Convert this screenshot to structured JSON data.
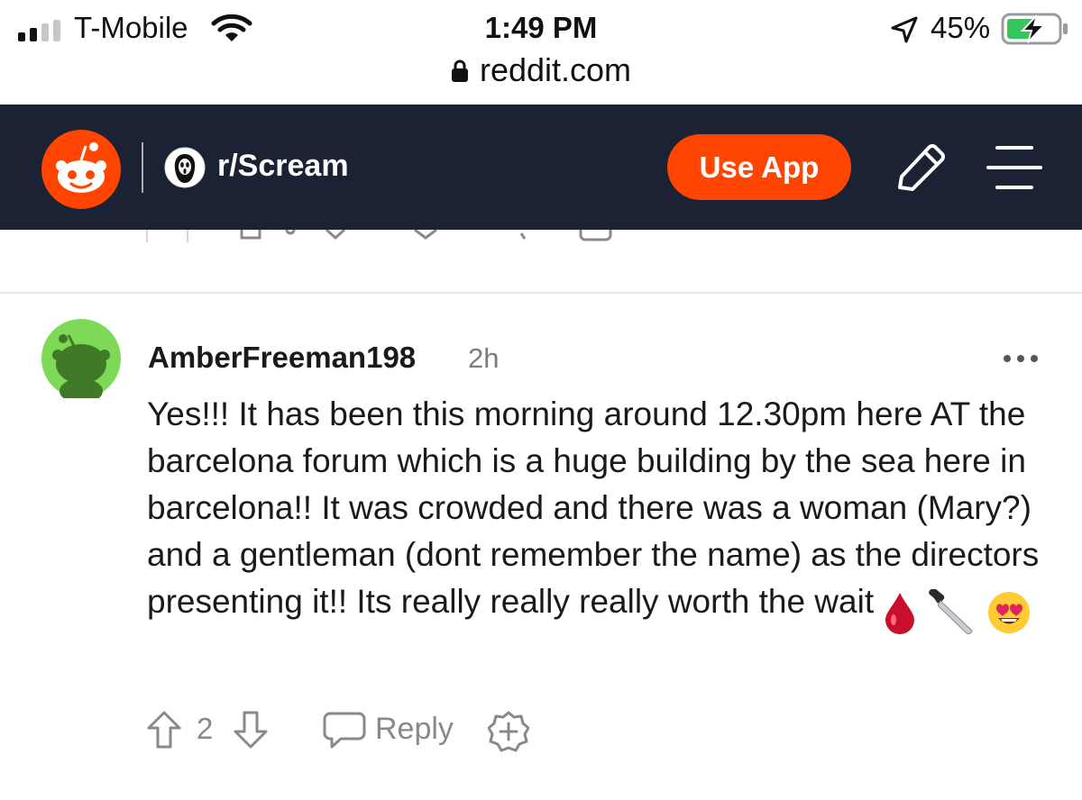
{
  "status_bar": {
    "carrier": "T-Mobile",
    "time": "1:49 PM",
    "url": "reddit.com",
    "battery_percent": "45%",
    "icons": [
      "signal-icon",
      "wifi-icon",
      "lock-icon",
      "location-arrow-icon",
      "battery-charging-icon"
    ]
  },
  "header": {
    "logo_icon": "reddit-snoo-logo",
    "subreddit_icon": "ghostface-icon",
    "subreddit": "r/Scream",
    "use_app_label": "Use App",
    "use_app_color": "#ff4500",
    "header_bg": "#1a2233",
    "icons": [
      "pencil-icon",
      "menu-icon"
    ]
  },
  "comment": {
    "author": "AmberFreeman198",
    "age": "2h",
    "avatar_icon": "snoo-avatar-icon",
    "avatar_bg": "#7ed957",
    "body": "Yes!!! It has been this morning around 12.30pm here AT the barcelona forum which is a huge building by the sea here in barcelona!! It was crowded and there was a woman (Mary?) and a gentleman (dont remember the name) as the directors presenting it!! Its really really really worth the wait",
    "body_emojis": [
      "drop-of-blood-emoji",
      "kitchen-knife-emoji",
      "heart-eyes-emoji"
    ],
    "score": "2",
    "reply_label": "Reply",
    "action_icons": [
      "upvote-icon",
      "downvote-icon",
      "reply-icon",
      "award-icon",
      "more-options-icon"
    ]
  }
}
